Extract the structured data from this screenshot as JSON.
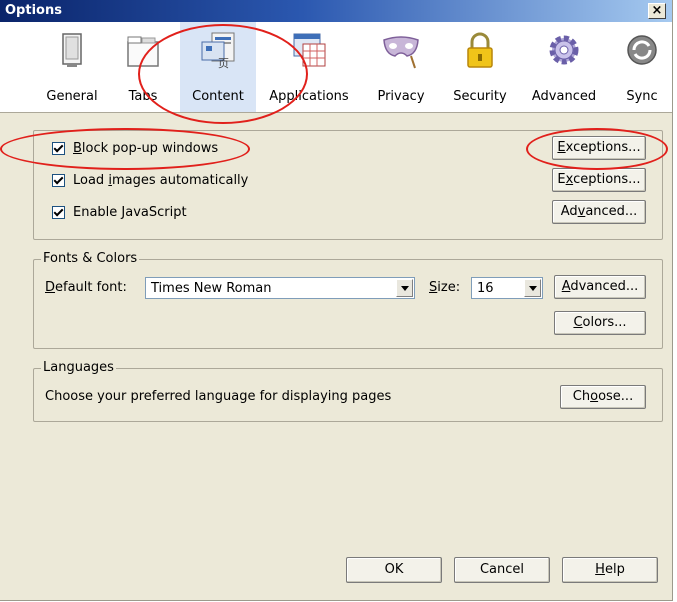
{
  "window": {
    "title": "Options",
    "close_label": "×"
  },
  "toolbar": {
    "tabs": [
      {
        "label": "General",
        "icon": "general-icon"
      },
      {
        "label": "Tabs",
        "icon": "tabs-icon"
      },
      {
        "label": "Content",
        "icon": "content-icon",
        "selected": true
      },
      {
        "label": "Applications",
        "icon": "applications-icon"
      },
      {
        "label": "Privacy",
        "icon": "privacy-icon"
      },
      {
        "label": "Security",
        "icon": "security-icon"
      },
      {
        "label": "Advanced",
        "icon": "advanced-icon"
      },
      {
        "label": "Sync",
        "icon": "sync-icon"
      }
    ]
  },
  "content": {
    "block_popups": {
      "pre": "",
      "key": "B",
      "post": "lock pop-up windows",
      "checked": true
    },
    "load_images": {
      "pre": "Load ",
      "key": "i",
      "post": "mages automatically",
      "checked": true
    },
    "enable_js": {
      "pre": "Enable ",
      "key": "J",
      "post": "avaScript",
      "checked": true
    },
    "exceptions1": {
      "pre": "",
      "key": "E",
      "post": "xceptions..."
    },
    "exceptions2": {
      "pre": "E",
      "key": "x",
      "post": "ceptions..."
    },
    "advanced_js": {
      "pre": "Ad",
      "key": "v",
      "post": "anced..."
    }
  },
  "fonts": {
    "legend": "Fonts & Colors",
    "default_font_label": {
      "pre": "",
      "key": "D",
      "post": "efault font:"
    },
    "default_font_value": "Times New Roman",
    "size_label": {
      "pre": "",
      "key": "S",
      "post": "ize:"
    },
    "size_value": "16",
    "advanced_btn": {
      "pre": "",
      "key": "A",
      "post": "dvanced..."
    },
    "colors_btn": {
      "pre": "",
      "key": "C",
      "post": "olors..."
    }
  },
  "languages": {
    "legend": "Languages",
    "description": "Choose your preferred language for displaying pages",
    "choose_btn": {
      "pre": "Ch",
      "key": "o",
      "post": "ose..."
    }
  },
  "footer": {
    "ok": "OK",
    "cancel": "Cancel",
    "help": {
      "pre": "",
      "key": "H",
      "post": "elp"
    }
  },
  "colors": {
    "annotation": "#e1201b",
    "selected_tab": "#d9e5f6",
    "dialog_bg": "#ece9d8"
  }
}
